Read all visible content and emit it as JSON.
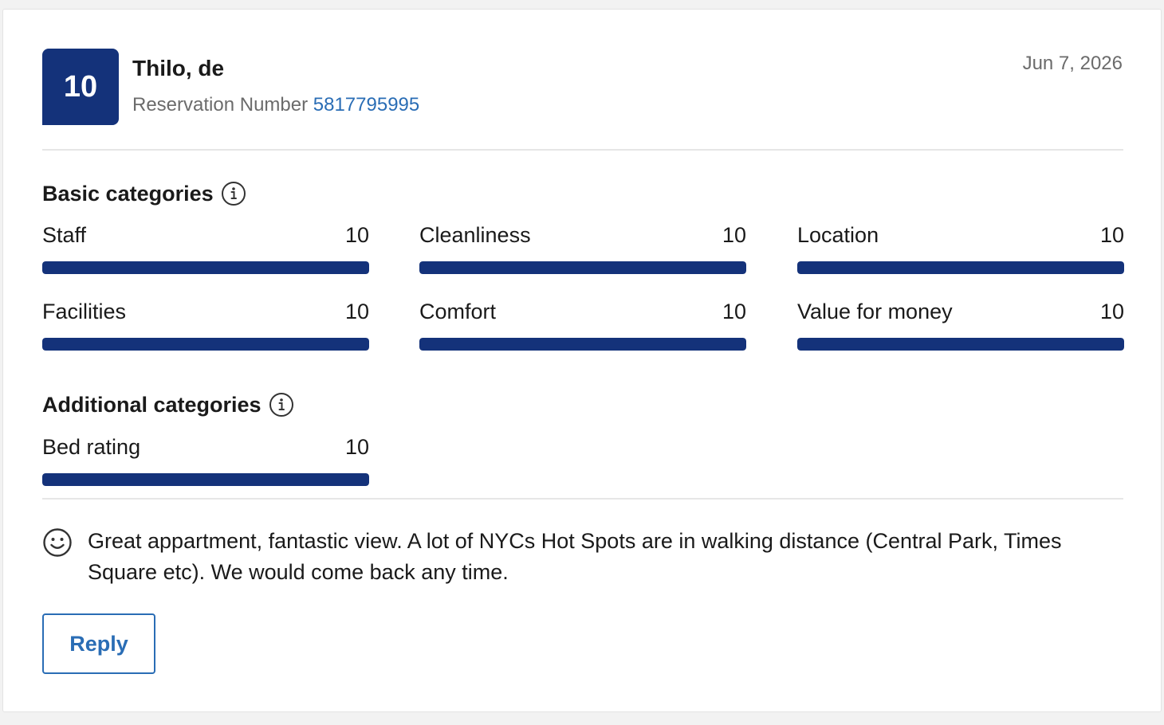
{
  "review": {
    "score": "10",
    "reviewer": "Thilo, de",
    "reservation_label": "Reservation Number",
    "reservation_number": "5817795995",
    "date": "Jun 7, 2026",
    "comment": "Great appartment, fantastic view. A lot of NYCs Hot Spots are in walking distance (Central Park, Times Square etc). We would come back any time."
  },
  "basic": {
    "title": "Basic categories",
    "categories": [
      {
        "label": "Staff",
        "value": "10",
        "fill_fraction": 1.0
      },
      {
        "label": "Cleanliness",
        "value": "10",
        "fill_fraction": 1.0
      },
      {
        "label": "Location",
        "value": "10",
        "fill_fraction": 1.0
      },
      {
        "label": "Facilities",
        "value": "10",
        "fill_fraction": 1.0
      },
      {
        "label": "Comfort",
        "value": "10",
        "fill_fraction": 1.0
      },
      {
        "label": "Value for money",
        "value": "10",
        "fill_fraction": 1.0
      }
    ]
  },
  "additional": {
    "title": "Additional categories",
    "categories": [
      {
        "label": "Bed rating",
        "value": "10",
        "fill_fraction": 1.0
      }
    ]
  },
  "actions": {
    "reply_label": "Reply"
  },
  "colors": {
    "brand_navy": "#14327a",
    "link_blue": "#2a6db5",
    "muted_text": "#6b6b6b"
  },
  "icons": {
    "info": "info-circle-icon",
    "comment": "smiley-face-icon"
  }
}
